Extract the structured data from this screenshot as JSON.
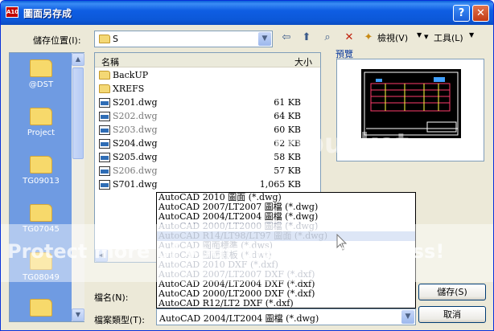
{
  "window": {
    "title": "圖面另存成",
    "icon_text": "A10",
    "help_label": "?",
    "close_label": "✕"
  },
  "toolbar": {
    "save_in_label": "儲存位置(I):",
    "location_value": "S",
    "views_label": "檢視(V)",
    "tools_label": "工具(L)"
  },
  "places": [
    {
      "label": "@DST"
    },
    {
      "label": "Project"
    },
    {
      "label": "TG09013"
    },
    {
      "label": "TG07045"
    },
    {
      "label": "TG08049"
    },
    {
      "label": ""
    }
  ],
  "file_list": {
    "col_name": "名稱",
    "col_size": "大小",
    "rows": [
      {
        "name": "BackUP",
        "size": "",
        "type": "folder"
      },
      {
        "name": "XREFS",
        "size": "",
        "type": "folder"
      },
      {
        "name": "S201.dwg",
        "size": "61 KB",
        "type": "dwg"
      },
      {
        "name": "S202.dwg",
        "size": "64 KB",
        "type": "dwg"
      },
      {
        "name": "S203.dwg",
        "size": "60 KB",
        "type": "dwg"
      },
      {
        "name": "S204.dwg",
        "size": "62 KB",
        "type": "dwg"
      },
      {
        "name": "S205.dwg",
        "size": "58 KB",
        "type": "dwg"
      },
      {
        "name": "S206.dwg",
        "size": "57 KB",
        "type": "dwg"
      },
      {
        "name": "S701.dwg",
        "size": "1,065 KB",
        "type": "dwg"
      }
    ]
  },
  "preview": {
    "label": "預覽"
  },
  "form": {
    "filename_label": "檔名(N):",
    "filetype_label": "檔案類型(T):",
    "filetype_value": "AutoCAD 2004/LT2004 圖檔 (*.dwg)"
  },
  "buttons": {
    "save": "儲存(S)",
    "cancel": "取消"
  },
  "filetype_options": [
    "AutoCAD 2010 圖面 (*.dwg)",
    "AutoCAD 2007/LT2007 圖檔 (*.dwg)",
    "AutoCAD 2004/LT2004 圖檔 (*.dwg)",
    "AutoCAD 2000/LT2000 圖檔 (*.dwg)",
    "AutoCAD R14/LT98/LT97 圖面 (*.dwg)",
    "AutoCAD 圖面標準 (*.dws)",
    "AutoCAD 圖面樣板 (*.dwt)",
    "AutoCAD 2010 DXF (*.dxf)",
    "AutoCAD 2007/LT2007 DXF (*.dxf)",
    "AutoCAD 2004/LT2004 DXF (*.dxf)",
    "AutoCAD 2000/LT2000 DXF (*.dxf)",
    "AutoCAD R12/LT2 DXF (*.dxf)"
  ],
  "watermark": {
    "brand": "photobucket",
    "tagline": "Protect more of your memories for less!"
  },
  "colors": {
    "titlebar": "#0c58d8",
    "places_bg": "#6f9be2",
    "dialog_bg": "#ece9d8",
    "highlight": "#c1d2ee"
  }
}
